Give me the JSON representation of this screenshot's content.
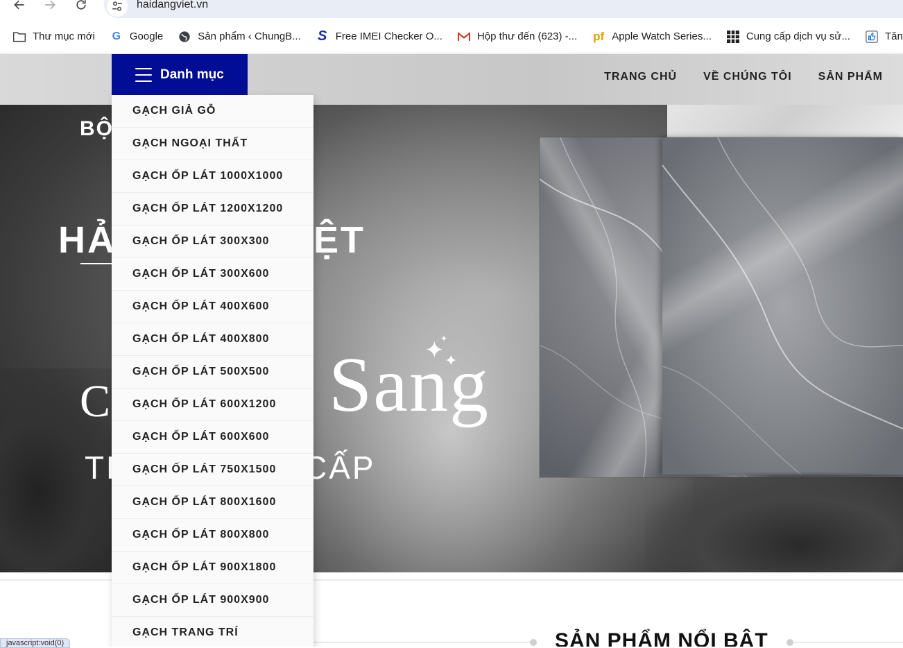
{
  "browser": {
    "url": "haidangviet.vn",
    "status_text": "javascript:void(0)",
    "bookmarks": [
      {
        "label": "Thư mục mới",
        "icon": "folder-icon"
      },
      {
        "label": "Google",
        "icon": "google-icon"
      },
      {
        "label": "Sản phẩm ‹ ChungB...",
        "icon": "globe-icon"
      },
      {
        "label": "Free IMEI Checker O...",
        "icon": "s-logo-icon"
      },
      {
        "label": "Hộp thư đến (623) -...",
        "icon": "gmail-icon"
      },
      {
        "label": "Apple Watch Series...",
        "icon": "pf-logo-icon"
      },
      {
        "label": "Cung cấp dịch vụ sử...",
        "icon": "grid-logo-icon"
      },
      {
        "label": "Tăng Like",
        "icon": "thumbs-up-icon"
      }
    ]
  },
  "header": {
    "category_label": "Danh mục",
    "nav": [
      "TRANG CHỦ",
      "VỀ CHÚNG TÔI",
      "SẢN PHẨM"
    ]
  },
  "categories": [
    "GẠCH GIẢ GỖ",
    "GẠCH NGOẠI THẤT",
    "GẠCH ỐP LÁT 1000X1000",
    "GẠCH ỐP LÁT 1200X1200",
    "GẠCH ỐP LÁT 300X300",
    "GẠCH ỐP LÁT 300X600",
    "GẠCH ỐP LÁT 400X600",
    "GẠCH ỐP LÁT 400X800",
    "GẠCH ỐP LÁT 500X500",
    "GẠCH ỐP LÁT 600X1200",
    "GẠCH ỐP LÁT 600X600",
    "GẠCH ỐP LÁT 750X1500",
    "GẠCH ỐP LÁT 800X1600",
    "GẠCH ỐP LÁT 800X800",
    "GẠCH ỐP LÁT 900X1800",
    "GẠCH ỐP LÁT 900X900",
    "GẠCH TRANG TRÍ"
  ],
  "hero": {
    "line1": "BỘ",
    "brand_left": "HẢ",
    "brand_right": "ỆT",
    "script_word": "Sang",
    "big_letter": "C",
    "tagline_left": "TR",
    "tagline_right": "CẤP"
  },
  "section": {
    "title": "SẢN PHẨM NỔI BẬT"
  },
  "colors": {
    "category_button": "#020d96",
    "bookmark_bar": "#ffffff"
  }
}
